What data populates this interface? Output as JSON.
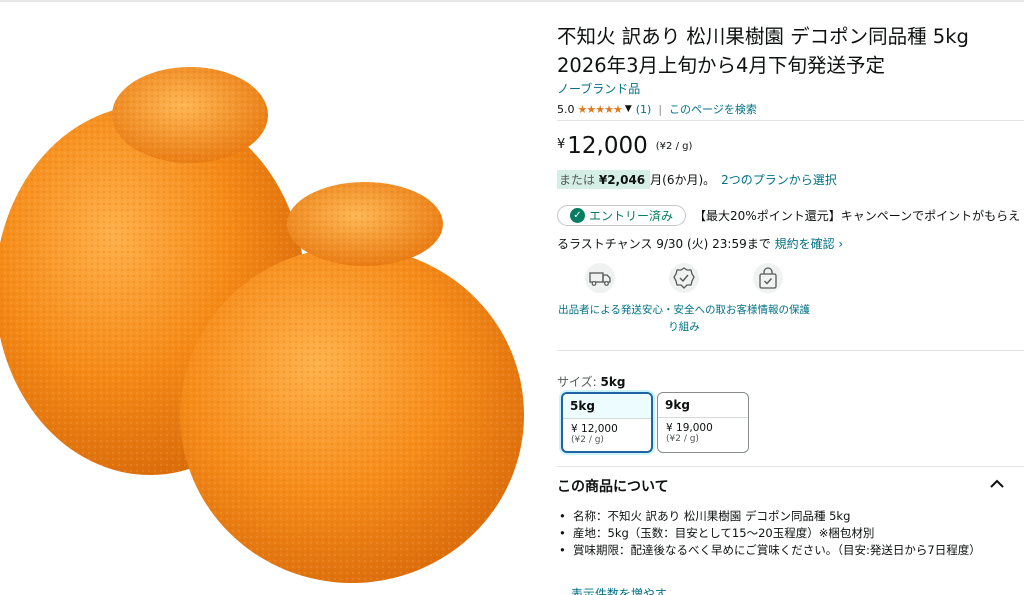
{
  "product": {
    "title_line1": "不知火 訳あり 松川果樹園 デコポン同品種 5kg",
    "title_line2": "2026年3月上旬から4月下旬発送予定",
    "brand": "ノーブランド品",
    "rating_value": "5.0",
    "stars": "★★★★★",
    "rating_count": "(1)",
    "search_page": "このページを検索",
    "currency_symbol": "¥",
    "price": "12,000",
    "unit_price": "(¥2 / g)",
    "monthly_prefix": "または",
    "monthly_amount": "¥2,046",
    "monthly_suffix": "月(6か月)。",
    "plans_link": "2つのプランから選択"
  },
  "campaign": {
    "entry_label": "エントリー済み",
    "text": "【最大20%ポイント還元】キャンペーンでポイントがもらえるラストチャンス 9/30 (火) 23:59まで",
    "terms_link": "規約を確認 ›"
  },
  "features": [
    {
      "label": "出品者による発送",
      "icon": "truck-icon"
    },
    {
      "label": "安心・安全への取り組み",
      "icon": "shield-badge-icon"
    },
    {
      "label": "お客様情報の保護",
      "icon": "secure-bag-icon"
    }
  ],
  "size": {
    "label": "サイズ:",
    "selected": "5kg",
    "options": [
      {
        "name": "5kg",
        "price": "¥ 12,000",
        "unit": "(¥2 / g)"
      },
      {
        "name": "9kg",
        "price": "¥ 19,000",
        "unit": "(¥2 / g)"
      }
    ]
  },
  "about": {
    "heading": "この商品について",
    "bullets": [
      "名称：不知火 訳あり 松川果樹園 デコポン同品種 5kg",
      "産地：5kg（玉数：目安として15～20玉程度）※梱包材別",
      "賞味期限：配達後なるべく早めにご賞味ください。（目安:発送日から7日程度）"
    ],
    "more": "表示件数を増やす"
  },
  "colors": {
    "link": "#007185",
    "star": "#de7921",
    "selected_border": "#2162a1",
    "monthly_bg": "#d5eee6",
    "orange": "#f28a1c"
  }
}
